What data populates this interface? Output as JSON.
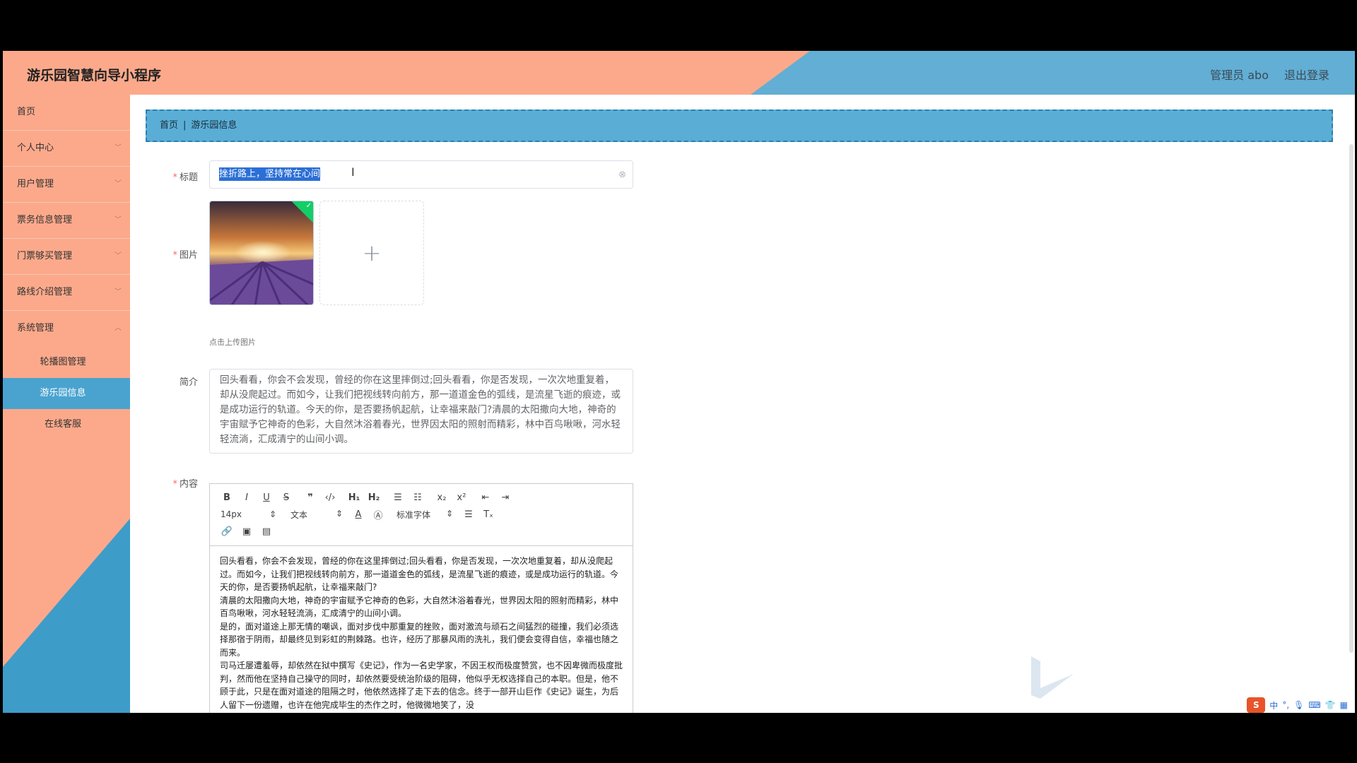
{
  "header": {
    "app_title": "游乐园智慧向导小程序",
    "user_label": "管理员 abo",
    "logout_label": "退出登录"
  },
  "sidebar": {
    "items": [
      {
        "label": "首页"
      },
      {
        "label": "个人中心"
      },
      {
        "label": "用户管理"
      },
      {
        "label": "票务信息管理"
      },
      {
        "label": "门票够买管理"
      },
      {
        "label": "路线介绍管理"
      },
      {
        "label": "系统管理"
      }
    ],
    "sub_items": [
      {
        "label": "轮播图管理"
      },
      {
        "label": "游乐园信息"
      },
      {
        "label": "在线客服"
      }
    ]
  },
  "breadcrumb": {
    "home": "首页",
    "current": "游乐园信息"
  },
  "form": {
    "title_label": "标题",
    "title_value": "挫折路上，坚持常在心间",
    "image_label": "图片",
    "upload_tip": "点击上传图片",
    "intro_label": "简介",
    "intro_value": "回头看看，你会不会发现，曾经的你在这里摔倒过;回头看看，你是否发现，一次次地重复着，却从没爬起过。而如今，让我们把视线转向前方，那一道道金色的弧线，是流星飞逝的痕迹，或是成功运行的轨道。今天的你，是否要扬帆起航，让幸福来敲门?清晨的太阳撒向大地，神奇的宇宙赋予它神奇的色彩，大自然沐浴着春光，世界因太阳的照射而精彩，林中百鸟啾啾，河水轻轻流淌，汇成清宁的山间小调。",
    "content_label": "内容"
  },
  "editor": {
    "font_size": "14px",
    "header_picker": "文本",
    "font_picker": "标准字体",
    "paragraphs": [
      "回头看看，你会不会发现，曾经的你在这里摔倒过;回头看看，你是否发现，一次次地重复着，却从没爬起过。而如今，让我们把视线转向前方，那一道道金色的弧线，是流星飞逝的痕迹，或是成功运行的轨道。今天的你，是否要扬帆起航，让幸福来敲门?",
      "清晨的太阳撒向大地，神奇的宇宙赋予它神奇的色彩，大自然沐浴着春光，世界因太阳的照射而精彩，林中百鸟啾啾，河水轻轻流淌，汇成清宁的山间小调。",
      "是的，面对道途上那无情的嘲讽，面对步伐中那重复的挫败，面对激流与顽石之间猛烈的碰撞，我们必须选择那宿于阴雨，却最终见到彩虹的荆棘路。也许，经历了那暴风雨的洗礼，我们便会变得自信，幸福也随之而来。",
      "司马迁屡遭羞辱，却依然在狱中撰写《史记》，作为一名史学家，不因王权而极度赞赏，也不因卑微而极度批判，然而他在坚持自己操守的同时，却依然要受统治阶级的阻碍，他似乎无权选择自己的本职。但是，他不顾于此，只是在面对道途的阻隔之时，他依然选择了走下去的信念。终于一部开山巨作《史记》诞生，为后人留下一份遗赠，也许在他完成毕生的杰作之时，他微微地笑了，没"
    ]
  },
  "ime": {
    "logo": "S",
    "lang": "中"
  }
}
